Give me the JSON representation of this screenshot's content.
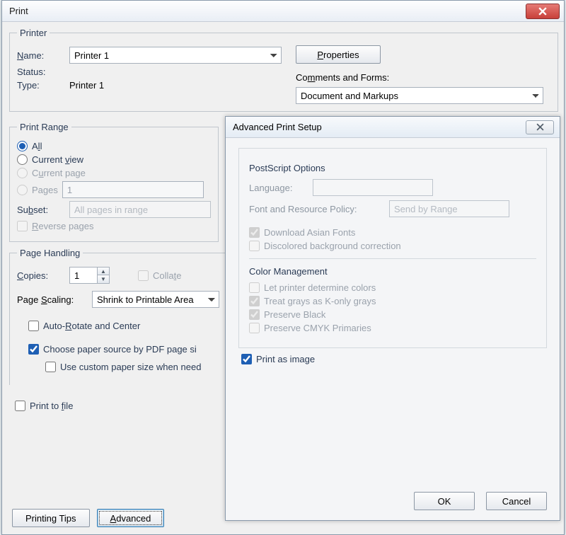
{
  "print": {
    "title": "Print",
    "close_glyph": "×",
    "printer": {
      "legend": "Printer",
      "name_label": "Name:",
      "name_value": "Printer 1",
      "properties_btn": "Properties",
      "status_label": "Status:",
      "status_value": "",
      "type_label": "Type:",
      "type_value": "Printer 1",
      "comments_label": "Comments and Forms:",
      "comments_value": "Document and Markups"
    },
    "range": {
      "legend": "Print Range",
      "all": "All",
      "current_view": "Current view",
      "current_page": "Current page",
      "pages": "Pages",
      "pages_value": "1",
      "subset_label": "Subset:",
      "subset_value": "All pages in range",
      "reverse": "Reverse pages"
    },
    "handling": {
      "legend": "Page Handling",
      "copies_label": "Copies:",
      "copies_value": "1",
      "collate": "Collate",
      "scaling_label": "Page Scaling:",
      "scaling_value": "Shrink to Printable Area",
      "auto_rotate": "Auto-Rotate and Center",
      "choose_source": "Choose paper source by PDF page si",
      "custom_paper": "Use custom paper size when need"
    },
    "print_to_file": "Print to file",
    "printing_tips_btn": "Printing Tips",
    "advanced_btn": "Advanced"
  },
  "advanced": {
    "title": "Advanced Print Setup",
    "ps": {
      "heading": "PostScript Options",
      "language_label": "Language:",
      "language_value": "",
      "policy_label": "Font and Resource Policy:",
      "policy_value": "Send by Range",
      "download_asian": "Download Asian Fonts",
      "discolored": "Discolored background correction"
    },
    "color": {
      "heading": "Color Management",
      "printer_colors": "Let printer determine colors",
      "konly": "Treat grays as K-only grays",
      "preserve_black": "Preserve Black",
      "preserve_cmyk": "Preserve CMYK Primaries"
    },
    "print_as_image": "Print as image",
    "ok_btn": "OK",
    "cancel_btn": "Cancel"
  }
}
